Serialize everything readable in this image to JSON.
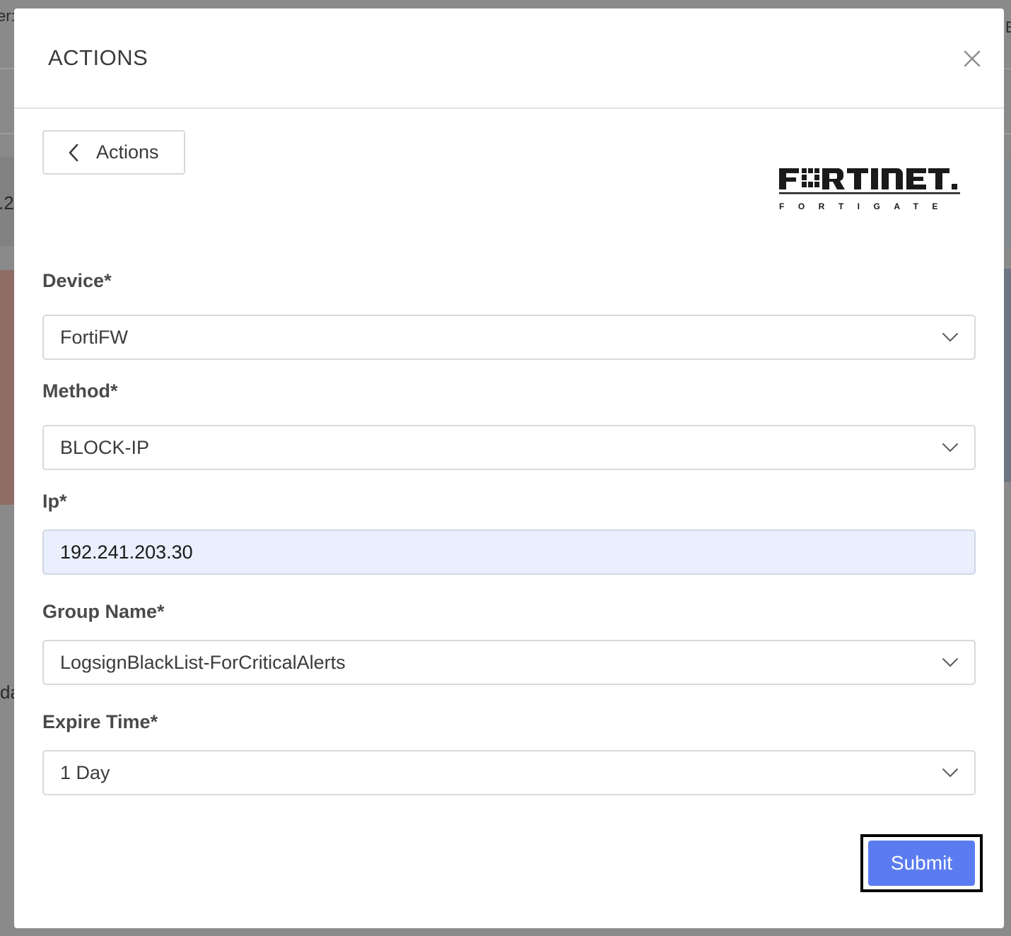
{
  "background": {
    "fragments": [
      "er:",
      ".2",
      "da",
      "E"
    ]
  },
  "modal": {
    "title": "ACTIONS",
    "close_icon": "close-icon",
    "back_button_label": "Actions",
    "back_icon": "chevron-left-icon",
    "logo": {
      "brand": "FORTINET.",
      "product": "FORTIGATE"
    },
    "fields": {
      "device": {
        "label": "Device*",
        "value": "FortiFW"
      },
      "method": {
        "label": "Method*",
        "value": "BLOCK-IP"
      },
      "ip": {
        "label": "Ip*",
        "value": "192.241.203.30"
      },
      "group_name": {
        "label": "Group Name*",
        "value": "LogsignBlackList-ForCriticalAlerts"
      },
      "expire_time": {
        "label": "Expire Time*",
        "value": "1 Day"
      }
    },
    "submit_label": "Submit"
  },
  "colors": {
    "accent": "#5b7cf0",
    "input_fill": "#e9effc",
    "overlay": "#8a8a8a"
  }
}
